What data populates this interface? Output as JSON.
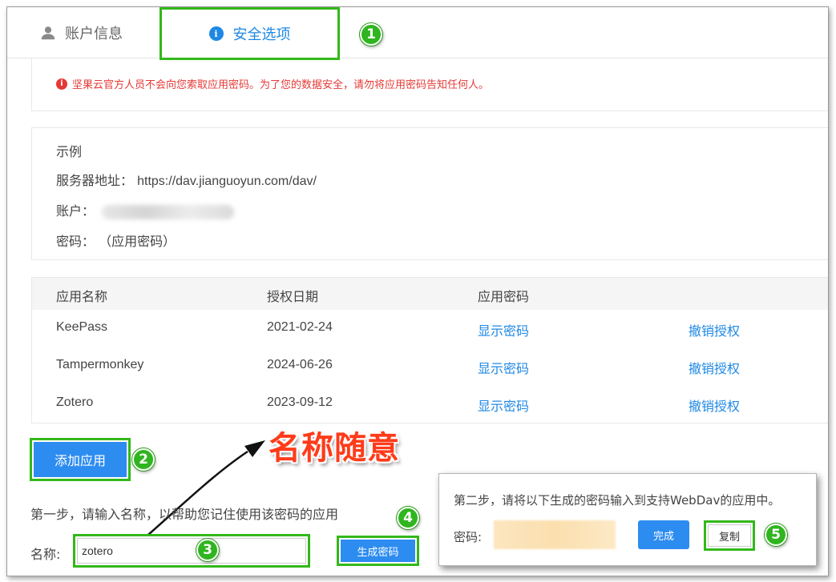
{
  "tabs": {
    "account_label": "账户信息",
    "security_label": "安全选项"
  },
  "warning": "坚果云官方人员不会向您索取应用密码。为了您的数据安全，请勿将应用密码告知任何人。",
  "example": {
    "title": "示例",
    "server_label": "服务器地址：",
    "server_value": "https://dav.jianguoyun.com/dav/",
    "account_label": "账户：",
    "password_label": "密码：",
    "password_value": "（应用密码）"
  },
  "table": {
    "headers": [
      "应用名称",
      "授权日期",
      "应用密码"
    ],
    "rows": [
      {
        "name": "KeePass",
        "date": "2021-02-24",
        "show": "显示密码",
        "revoke": "撤销授权"
      },
      {
        "name": "Tampermonkey",
        "date": "2024-06-26",
        "show": "显示密码",
        "revoke": "撤销授权"
      },
      {
        "name": "Zotero",
        "date": "2023-09-12",
        "show": "显示密码",
        "revoke": "撤销授权"
      }
    ]
  },
  "add_button": "添加应用",
  "step1": "第一步，请输入名称，以帮助您记住使用该密码的应用",
  "name_label": "名称:",
  "name_value": "zotero",
  "generate_button": "生成密码",
  "annotation": "名称随意",
  "badges": [
    "1",
    "2",
    "3",
    "4",
    "5"
  ],
  "popup": {
    "title": "第二步，请将以下生成的密码输入到支持WebDav的应用中。",
    "password_label": "密码:",
    "done_button": "完成",
    "copy_button": "复制"
  },
  "colors": {
    "accent": "#1e88e5",
    "primary_button": "#2d8cf0",
    "highlight": "#33b81a",
    "warning": "#e53935",
    "annotation": "#ff3b1a"
  }
}
